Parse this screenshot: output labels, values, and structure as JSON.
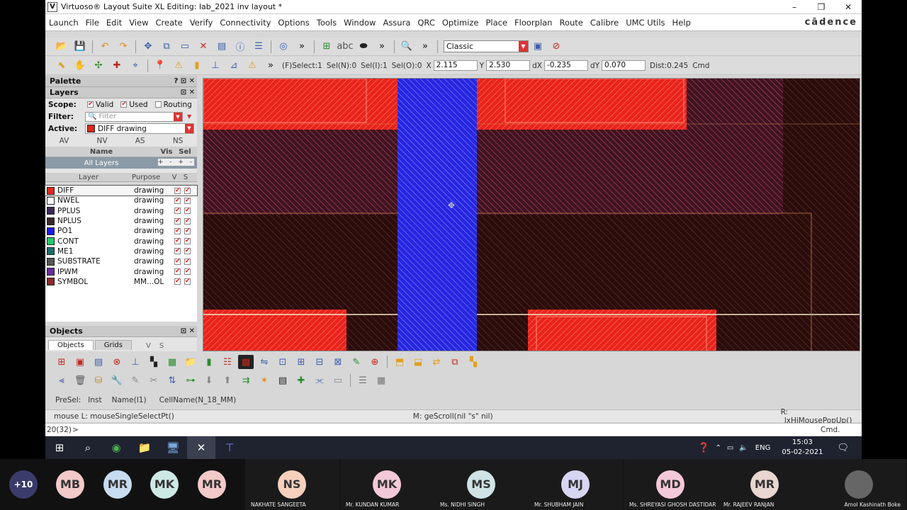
{
  "window": {
    "title": "Virtuoso® Layout Suite XL Editing: lab_2021 inv layout *",
    "min": "–",
    "max": "❐",
    "close": "✕"
  },
  "menu": {
    "items": [
      "Launch",
      "File",
      "Edit",
      "View",
      "Create",
      "Verify",
      "Connectivity",
      "Options",
      "Tools",
      "Window",
      "Assura",
      "QRC",
      "Optimize",
      "Place",
      "Floorplan",
      "Route",
      "Calibre",
      "UMC Utils",
      "Help"
    ],
    "brand": "cādence"
  },
  "toolbar1": {
    "more1": "»",
    "more2": "»",
    "more3": "»",
    "workspace": "Classic"
  },
  "toolbar2": {
    "more": "»",
    "fselect": "(F)Select:1",
    "seln": "Sel(N):0",
    "seli": "Sel(I):1",
    "selo": "Sel(O):0",
    "x_label": "X",
    "x_value": "2.115",
    "y_label": "Y",
    "y_value": "2.530",
    "dx_label": "dX",
    "dx_value": "-0.235",
    "dy_label": "dY",
    "dy_value": "0.070",
    "dist": "Dist:0.245",
    "cmd": "Cmd"
  },
  "palette": {
    "title": "Palette",
    "controls": "? ⊡ ✕",
    "layers_title": "Layers",
    "layers_controls": "⊡ ✕",
    "scope_label": "Scope:",
    "valid": "Valid",
    "used": "Used",
    "routing": "Routing",
    "filter_label": "Filter:",
    "filter_placeholder": "Filter",
    "active_label": "Active:",
    "active_value": "DIFF drawing",
    "vis_cols": [
      "AV",
      "NV",
      "AS",
      "NS"
    ],
    "name_header": "Name",
    "vis_header": "Vis",
    "sel_header": "Sel",
    "all_layers": "All Layers",
    "layer_header": "Layer",
    "purpose_header": "Purpose",
    "v_header": "V",
    "s_header": "S",
    "layers": [
      {
        "name": "DIFF",
        "purpose": "drawing",
        "color": "#e0281e"
      },
      {
        "name": "NWEL",
        "purpose": "drawing",
        "color": "#ffffff"
      },
      {
        "name": "PPLUS",
        "purpose": "drawing",
        "color": "#3a2a5a"
      },
      {
        "name": "NPLUS",
        "purpose": "drawing",
        "color": "#3a2a2a"
      },
      {
        "name": "PO1",
        "purpose": "drawing",
        "color": "#1a1aee"
      },
      {
        "name": "CONT",
        "purpose": "drawing",
        "color": "#22cc66"
      },
      {
        "name": "ME1",
        "purpose": "drawing",
        "color": "#1e6e6e"
      },
      {
        "name": "SUBSTRATE",
        "purpose": "drawing",
        "color": "#555555"
      },
      {
        "name": "IPWM",
        "purpose": "drawing",
        "color": "#6a2a9a"
      },
      {
        "name": "SYMBOL",
        "purpose": "MM...OL",
        "color": "#8a2a2a"
      }
    ],
    "objects_title": "Objects",
    "objects_controls": "⊡ ✕",
    "tab_objects": "Objects",
    "tab_grids": "Grids",
    "tab_v": "V",
    "tab_s": "S"
  },
  "prompt_bar": {
    "preset": "PreSel:",
    "inst": "Inst",
    "name": "Name(I1)",
    "cellname": "CellName(N_18_MM)"
  },
  "mouse_bar": {
    "left": "mouse L: mouseSingleSelectPt()",
    "middle": "M: geScroll(nil \"s\"    nil)",
    "right": "R: _lxHiMousePopUp()"
  },
  "cmd_bar": {
    "counter": "20(32)",
    "prompt": ">",
    "mode": "Cmd."
  },
  "taskbar": {
    "lang": "ENG",
    "time": "15:03",
    "date": "05-02-2021"
  },
  "participants": [
    {
      "initials": "+10",
      "name": "",
      "color": "#3b3b6b",
      "text": "#fff"
    },
    {
      "initials": "MB",
      "name": "",
      "color": "#f3c9c9",
      "text": "#333"
    },
    {
      "initials": "MR",
      "name": "",
      "color": "#c7dcef",
      "text": "#333"
    },
    {
      "initials": "MK",
      "name": "",
      "color": "#cde9e6",
      "text": "#333"
    },
    {
      "initials": "MR",
      "name": "",
      "color": "#f3c9c9",
      "text": "#333"
    },
    {
      "initials": "NS",
      "name": "NAKHATE SANGEETA",
      "color": "#f6d0bd",
      "text": "#333"
    },
    {
      "initials": "MK",
      "name": "Mr. KUNDAN KUMAR",
      "color": "#f4c8d8",
      "text": "#333"
    },
    {
      "initials": "MS",
      "name": "Ms. NIDHI SINGH",
      "color": "#cfe3e6",
      "text": "#333"
    },
    {
      "initials": "MJ",
      "name": "Mr. SHUBHAM JAIN",
      "color": "#d6d6f2",
      "text": "#333"
    },
    {
      "initials": "MD",
      "name": "Ms. SHREYASI GHOSH DASTIDAR",
      "color": "#f4c8d8",
      "text": "#333"
    },
    {
      "initials": "MR",
      "name": "Mr. RAJEEV RANJAN",
      "color": "#e9d6d0",
      "text": "#333"
    },
    {
      "initials": "",
      "name": "Amol Kashinath Boke",
      "color": "#666",
      "text": "#fff"
    }
  ]
}
